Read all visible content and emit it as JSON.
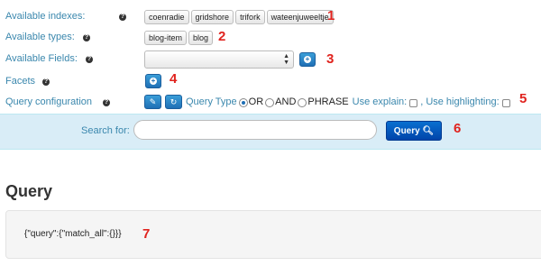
{
  "indexes": {
    "label": "Available indexes:",
    "chips": [
      "coenradie",
      "gridshore",
      "trifork",
      "wateenjuweeltje"
    ],
    "marker": "1"
  },
  "types": {
    "label": "Available types:",
    "chips": [
      "blog-item",
      "blog"
    ],
    "marker": "2"
  },
  "fields": {
    "label": "Available Fields:",
    "selected_value": "",
    "marker": "3"
  },
  "facets": {
    "label": "Facets",
    "marker": "4"
  },
  "query_config": {
    "label": "Query configuration",
    "query_type_label": "Query Type",
    "options": [
      "OR",
      "AND",
      "PHRASE"
    ],
    "selected_option": "OR",
    "use_explain_label": "Use explain:",
    "use_highlighting_label": ", Use highlighting:",
    "marker": "5"
  },
  "search": {
    "label": "Search for:",
    "value": "",
    "button_label": "Query",
    "marker": "6"
  },
  "result": {
    "heading": "Query",
    "query_json": "{\"query\":{\"match_all\":{}}}",
    "marker": "7"
  },
  "colors": {
    "label_blue": "#3a87ad",
    "marker_red": "#e0231e",
    "button_blue": "#1f6fb5",
    "search_bar_bg": "#d9edf7"
  },
  "icons": {
    "help": "question-circle-icon",
    "add": "plus-circle-icon",
    "edit": "edit-icon",
    "refresh": "refresh-icon",
    "search": "search-icon",
    "select_arrows": "updown-arrows-icon"
  }
}
